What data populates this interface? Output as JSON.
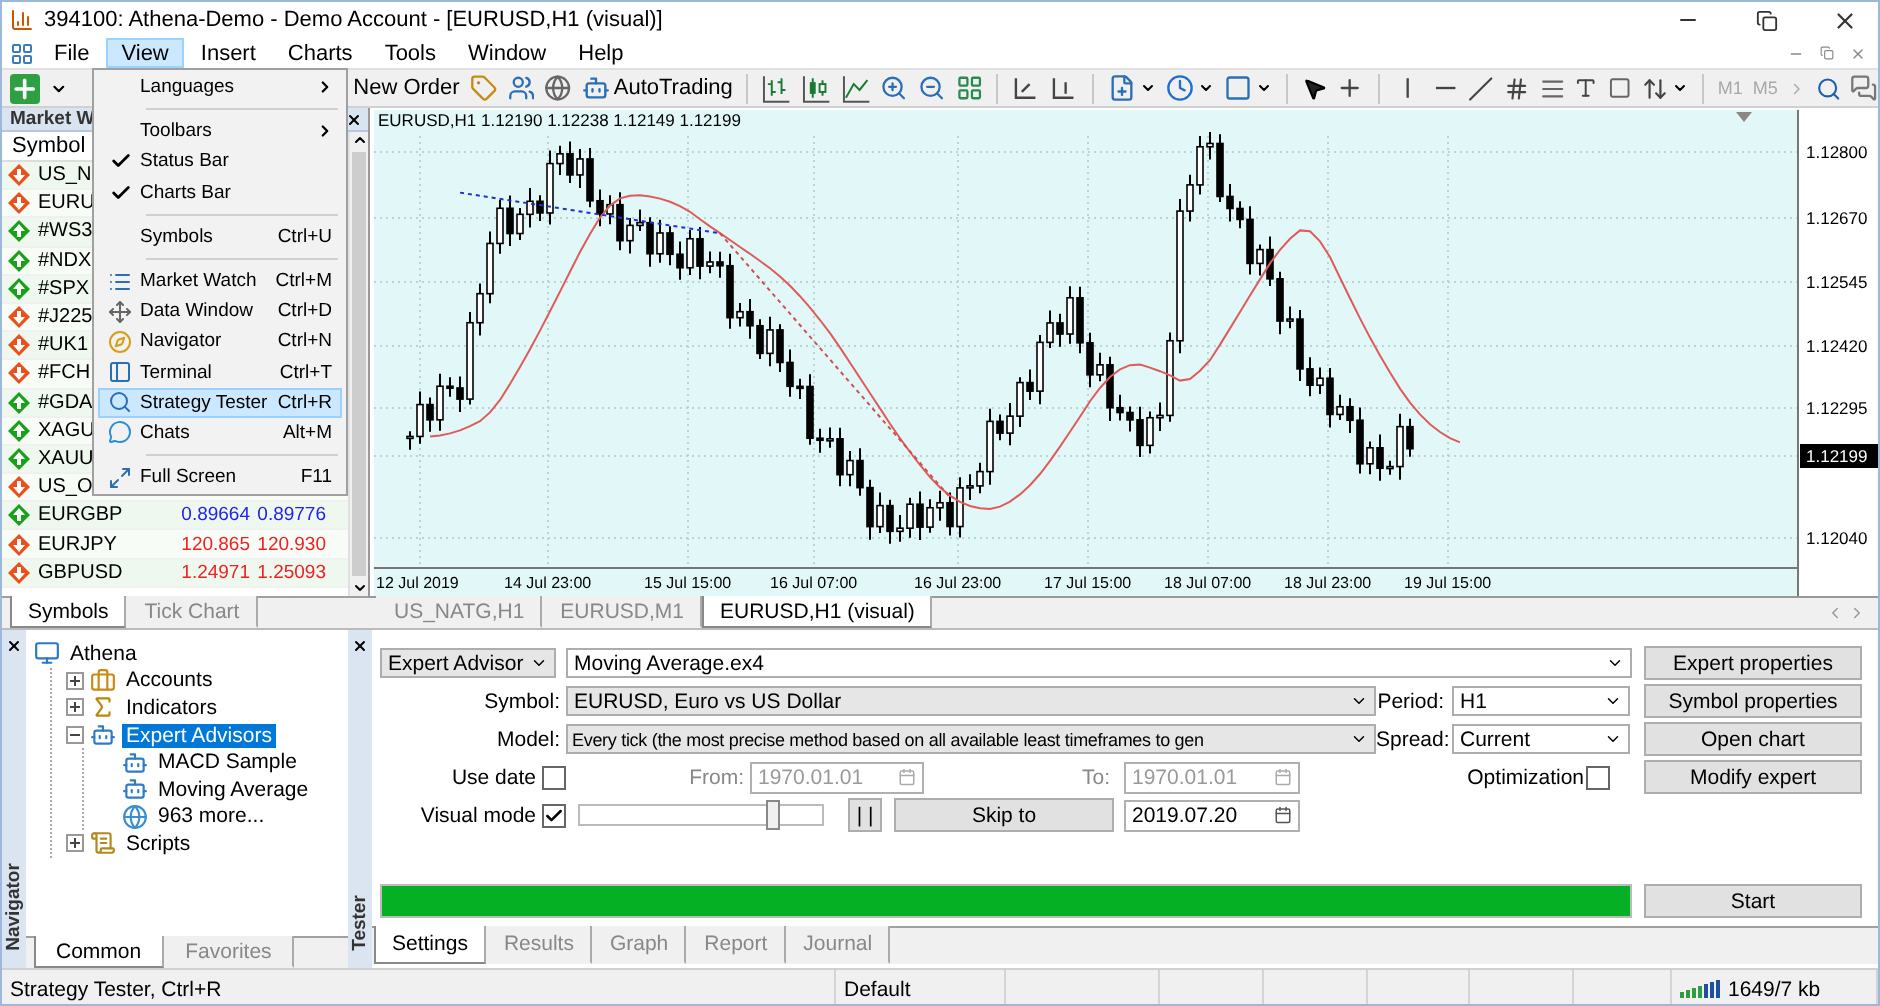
{
  "window": {
    "title": "394100: Athena-Demo - Demo Account - [EURUSD,H1 (visual)]"
  },
  "menu_bar": [
    {
      "label": "File",
      "selected": false
    },
    {
      "label": "View",
      "selected": true
    },
    {
      "label": "Insert",
      "selected": false
    },
    {
      "label": "Charts",
      "selected": false
    },
    {
      "label": "Tools",
      "selected": false
    },
    {
      "label": "Window",
      "selected": false
    },
    {
      "label": "Help",
      "selected": false
    }
  ],
  "view_menu": {
    "groups": [
      [
        {
          "label": "Languages",
          "kind": "submenu",
          "selected": false
        }
      ],
      [
        {
          "label": "Toolbars",
          "kind": "submenu",
          "selected": false
        },
        {
          "label": "Status Bar",
          "kind": "toggle",
          "checked": true,
          "selected": false
        },
        {
          "label": "Charts Bar",
          "kind": "toggle",
          "checked": true,
          "selected": false
        }
      ],
      [
        {
          "label": "Symbols",
          "shortcut": "Ctrl+U",
          "kind": "command",
          "selected": false
        }
      ],
      [
        {
          "label": "Market Watch",
          "shortcut": "Ctrl+M",
          "kind": "window",
          "selected": false
        },
        {
          "label": "Data Window",
          "shortcut": "Ctrl+D",
          "kind": "window",
          "selected": false
        },
        {
          "label": "Navigator",
          "shortcut": "Ctrl+N",
          "kind": "window",
          "selected": false
        },
        {
          "label": "Terminal",
          "shortcut": "Ctrl+T",
          "kind": "window",
          "selected": false
        },
        {
          "label": "Strategy Tester",
          "shortcut": "Ctrl+R",
          "kind": "window",
          "selected": true
        },
        {
          "label": "Chats",
          "shortcut": "Alt+M",
          "kind": "window",
          "selected": false
        }
      ],
      [
        {
          "label": "Full Screen",
          "shortcut": "F11",
          "kind": "window",
          "selected": false
        }
      ]
    ]
  },
  "toolbar": {
    "new_order": "New Order",
    "autotrading": "AutoTrading",
    "periods": [
      {
        "label": "M1",
        "disabled": true
      },
      {
        "label": "M5",
        "disabled": true
      }
    ]
  },
  "market_watch": {
    "title": "Market W",
    "column": "Symbol",
    "rows": [
      {
        "symbol": "US_N",
        "kind": "down"
      },
      {
        "symbol": "EURU",
        "kind": "down"
      },
      {
        "symbol": "#WS3",
        "kind": "up"
      },
      {
        "symbol": "#NDX",
        "kind": "up"
      },
      {
        "symbol": "#SPX",
        "kind": "up"
      },
      {
        "symbol": "#J225",
        "kind": "down"
      },
      {
        "symbol": "#UK1",
        "kind": "down"
      },
      {
        "symbol": "#FCH",
        "kind": "down"
      },
      {
        "symbol": "#GDA",
        "kind": "up"
      },
      {
        "symbol": "XAGU",
        "kind": "up"
      },
      {
        "symbol": "XAUU",
        "kind": "up"
      },
      {
        "symbol": "US_O",
        "kind": "down"
      },
      {
        "symbol": "EURGBP",
        "kind": "up",
        "bid": "0.89664",
        "ask": "0.89776"
      },
      {
        "symbol": "EURJPY",
        "kind": "down",
        "bid": "120.865",
        "ask": "120.930"
      },
      {
        "symbol": "GBPUSD",
        "kind": "down",
        "bid": "1.24971",
        "ask": "1.25093"
      }
    ],
    "tabs": [
      {
        "label": "Symbols",
        "selected": true
      },
      {
        "label": "Tick Chart",
        "selected": false
      }
    ]
  },
  "chart": {
    "header": "EURUSD,H1  1.12190 1.12238 1.12149 1.12199",
    "price_labels": [
      {
        "label": "1.12800",
        "kind": "tick"
      },
      {
        "label": "1.12670",
        "kind": "tick"
      },
      {
        "label": "1.12545",
        "kind": "tick"
      },
      {
        "label": "1.12420",
        "kind": "tick"
      },
      {
        "label": "1.12295",
        "kind": "tick"
      },
      {
        "label": "1.12199",
        "kind": "current"
      },
      {
        "label": "1.12040",
        "kind": "tick"
      }
    ],
    "time_labels": [
      "12 Jul 2019",
      "14 Jul 23:00",
      "15 Jul 15:00",
      "16 Jul 07:00",
      "16 Jul 23:00",
      "17 Jul 15:00",
      "18 Jul 07:00",
      "18 Jul 23:00",
      "19 Jul 15:00"
    ]
  },
  "chart_tabs": [
    {
      "label": "US_NATG,H1",
      "selected": false
    },
    {
      "label": "EURUSD,M1",
      "selected": false
    },
    {
      "label": "EURUSD,H1 (visual)",
      "selected": true
    }
  ],
  "navigator": {
    "title": "Navigator",
    "tree": [
      {
        "label": "Athena",
        "kind": "terminal",
        "selected": false,
        "children": [
          {
            "label": "Accounts",
            "kind": "accounts",
            "expanded": false,
            "selected": false
          },
          {
            "label": "Indicators",
            "kind": "indicators",
            "expanded": false,
            "selected": false
          },
          {
            "label": "Expert Advisors",
            "kind": "experts",
            "expanded": true,
            "selected": true,
            "children": [
              {
                "label": "MACD Sample",
                "kind": "expert",
                "selected": false
              },
              {
                "label": "Moving Average",
                "kind": "expert",
                "selected": false
              },
              {
                "label": "963 more...",
                "kind": "more",
                "selected": false
              }
            ]
          },
          {
            "label": "Scripts",
            "kind": "scripts",
            "expanded": false,
            "selected": false
          }
        ]
      }
    ],
    "tabs": [
      {
        "label": "Common",
        "selected": true
      },
      {
        "label": "Favorites",
        "selected": false
      }
    ]
  },
  "tester": {
    "title": "Tester",
    "mode": "Expert Advisor",
    "expert": "Moving Average.ex4",
    "symbol_label": "Symbol:",
    "symbol": "EURUSD, Euro vs US Dollar",
    "model_label": "Model:",
    "model": "Every tick (the most precise method based on all available least timeframes to gen",
    "period_label": "Period:",
    "period": "H1",
    "spread_label": "Spread:",
    "spread": "Current",
    "use_date": {
      "label": "Use date",
      "checked": false
    },
    "from": {
      "label": "From:",
      "value": "1970.01.01",
      "disabled": true
    },
    "to": {
      "label": "To:",
      "value": "1970.01.01",
      "disabled": true
    },
    "optimization": {
      "label": "Optimization",
      "checked": false
    },
    "visual_mode": {
      "label": "Visual mode",
      "checked": true
    },
    "speed": {
      "level": 0.8
    },
    "pause": "| |",
    "skip_to": "Skip to",
    "skip_date": {
      "value": "2019.07.20",
      "disabled": false
    },
    "progress": {
      "level": 1
    },
    "buttons": [
      "Expert properties",
      "Symbol properties",
      "Open chart",
      "Modify expert"
    ],
    "start": "Start",
    "tabs": [
      {
        "label": "Settings",
        "selected": true
      },
      {
        "label": "Results",
        "selected": false
      },
      {
        "label": "Graph",
        "selected": false
      },
      {
        "label": "Report",
        "selected": false
      },
      {
        "label": "Journal",
        "selected": false
      }
    ]
  },
  "status_bar": {
    "hint": "Strategy Tester, Ctrl+R",
    "profile": "Default",
    "traffic": "1649/7 kb"
  }
}
